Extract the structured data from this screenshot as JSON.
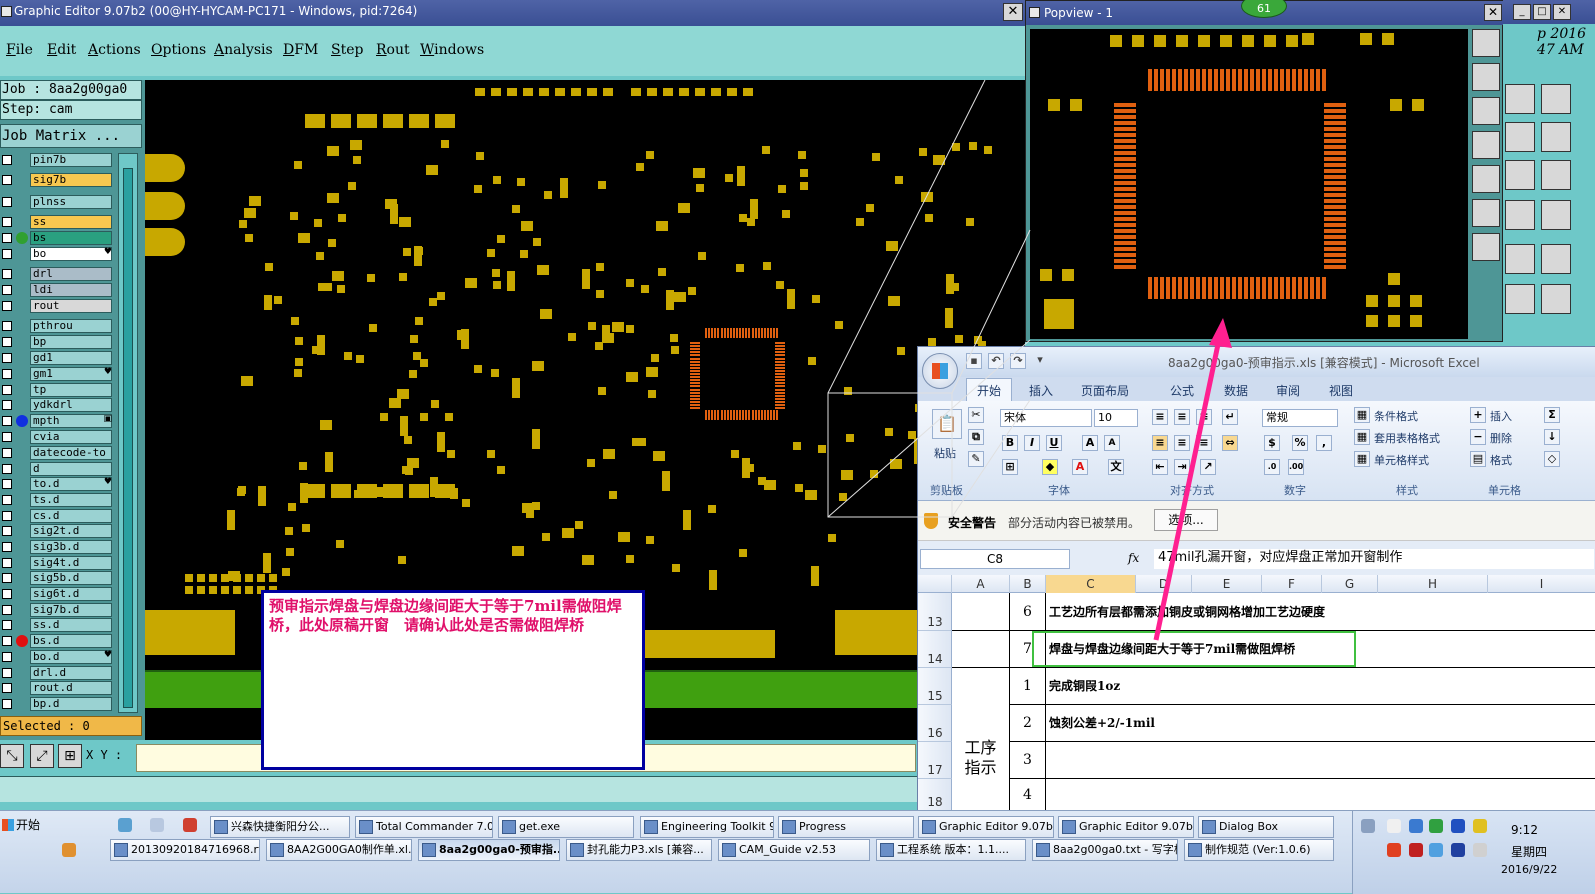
{
  "graphic_editor": {
    "title": "Graphic Editor 9.07b2 (00@HY-HYCAM-PC171 - Windows, pid:7264)",
    "menu": [
      "File",
      "Edit",
      "Actions",
      "Options",
      "Analysis",
      "DFM",
      "Step",
      "Rout",
      "Windows"
    ],
    "job_line": "Job : 8aa2g00ga0",
    "step_line": "Step: cam",
    "job_matrix": "Job Matrix ...",
    "selected": "Selected : 0",
    "xy_label": "X Y :",
    "layers": [
      {
        "name": "pin7b",
        "color": "#9ad2d2"
      },
      {
        "name": "sig7b",
        "color": "#f8c850"
      },
      {
        "name": "plnss",
        "color": "#9ad2d2"
      },
      {
        "name": "ss",
        "color": "#f8c850"
      },
      {
        "name": "bs",
        "color": "#2aa080",
        "dot": "#30a030"
      },
      {
        "name": "bo",
        "color": "#ffffff",
        "flag": "♥"
      },
      {
        "name": "drl",
        "color": "#aabcc8"
      },
      {
        "name": "ldi",
        "color": "#aabcc8"
      },
      {
        "name": "rout",
        "color": "#d8d8d8"
      },
      {
        "name": "pthrou",
        "color": "#9ad2d2"
      },
      {
        "name": "bp",
        "color": "#9ad2d2"
      },
      {
        "name": "gd1",
        "color": "#9ad2d2"
      },
      {
        "name": "gm1",
        "color": "#9ad2d2",
        "flag": "♥"
      },
      {
        "name": "tp",
        "color": "#9ad2d2"
      },
      {
        "name": "ydkdrl",
        "color": "#9ad2d2"
      },
      {
        "name": "mpth",
        "color": "#9ad2d2",
        "dot": "#1030e0",
        "flag": "▣"
      },
      {
        "name": "cvia",
        "color": "#9ad2d2"
      },
      {
        "name": "datecode-to",
        "color": "#9ad2d2"
      },
      {
        "name": "d",
        "color": "#9ad2d2"
      },
      {
        "name": "to.d",
        "color": "#9ad2d2",
        "flag": "♥"
      },
      {
        "name": "ts.d",
        "color": "#9ad2d2"
      },
      {
        "name": "cs.d",
        "color": "#9ad2d2"
      },
      {
        "name": "sig2t.d",
        "color": "#9ad2d2"
      },
      {
        "name": "sig3b.d",
        "color": "#9ad2d2"
      },
      {
        "name": "sig4t.d",
        "color": "#9ad2d2"
      },
      {
        "name": "sig5b.d",
        "color": "#9ad2d2"
      },
      {
        "name": "sig6t.d",
        "color": "#9ad2d2"
      },
      {
        "name": "sig7b.d",
        "color": "#9ad2d2"
      },
      {
        "name": "ss.d",
        "color": "#9ad2d2"
      },
      {
        "name": "bs.d",
        "color": "#9ad2d2",
        "dot": "#e01010"
      },
      {
        "name": "bo.d",
        "color": "#9ad2d2",
        "flag": "♥"
      },
      {
        "name": "drl.d",
        "color": "#9ad2d2"
      },
      {
        "name": "rout.d",
        "color": "#9ad2d2"
      },
      {
        "name": "bp.d",
        "color": "#9ad2d2"
      }
    ]
  },
  "annotation": {
    "text": "预审指示焊盘与焊盘边缘间距大于等于7mil需做阻焊桥，此处原稿开窗　请确认此处是否需做阻焊桥",
    "color": "#e0106a"
  },
  "popview": {
    "title": "Popview - 1",
    "badge": "61"
  },
  "right_window": {
    "clock_text": "p 2016\n47 AM"
  },
  "excel": {
    "title": "8aa2g00ga0-预审指示.xls  [兼容模式] - Microsoft Excel",
    "tabs": [
      "开始",
      "插入",
      "页面布局",
      "公式",
      "数据",
      "审阅",
      "视图"
    ],
    "ribbon": {
      "paste": "粘贴",
      "clipboard": "剪贴板",
      "font_name": "宋体",
      "font_size": "10",
      "font_group": "字体",
      "align_group": "对齐方式",
      "number_format": "常规",
      "number_group": "数字",
      "cond_format": "条件格式",
      "table_format": "套用表格格式",
      "cell_style": "单元格样式",
      "style_group": "样式",
      "insert": "插入",
      "delete": "删除",
      "format": "格式",
      "cells_group": "单元格"
    },
    "security": {
      "title": "安全警告",
      "message": "部分活动内容已被禁用。",
      "button": "选项..."
    },
    "name_box": "C8",
    "formula": "47mil孔漏开窗，对应焊盘正常加开窗制作",
    "columns": [
      "A",
      "B",
      "C",
      "D",
      "E",
      "F",
      "G",
      "H",
      "I"
    ],
    "rows": [
      {
        "row": "13",
        "b": "6",
        "c": "工艺边所有层都需添加铜皮或铜网格增加工艺边硬度"
      },
      {
        "row": "14",
        "b": "7",
        "c": "焊盘与焊盘边缘间距大于等于7mil需做阻焊桥"
      },
      {
        "row": "15",
        "b": "1",
        "c": "完成铜叚1oz"
      },
      {
        "row": "16",
        "b": "2",
        "c": "蚀刻公差+2/-1mil"
      },
      {
        "row": "17",
        "b": "3",
        "c": ""
      },
      {
        "row": "18",
        "b": "4",
        "c": ""
      }
    ],
    "merged_label": "工序\n指示"
  },
  "taskbar": {
    "start": "开始",
    "row1": [
      "兴森快捷衡阳分公...",
      "Total Commander 7.0...",
      "get.exe",
      "Engineering Toolkit 9...",
      "Progress",
      "Graphic Editor 9.07b...",
      "Graphic Editor 9.07b...",
      "Dialog Box"
    ],
    "row2": [
      "20130920184716968.rt...",
      "8AA2G00GA0制作单.xl...",
      "8aa2g00ga0-预审指...",
      "封孔能力P3.xls [兼容...",
      "CAM_Guide v2.53",
      "工程系统  版本：1.1....",
      "8aa2g00ga0.txt - 写字板",
      "制作规范 (Ver:1.0.6)"
    ],
    "time": "9:12",
    "day": "星期四",
    "date": "2016/9/22"
  }
}
